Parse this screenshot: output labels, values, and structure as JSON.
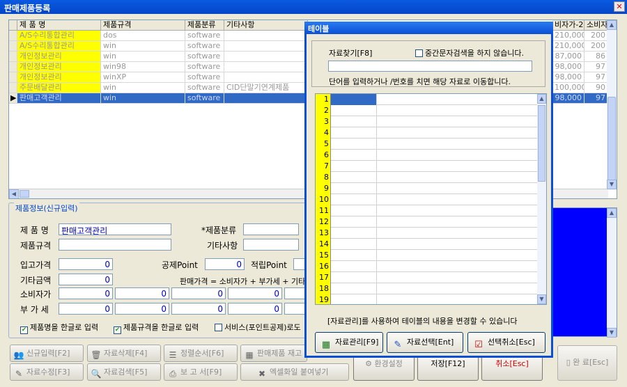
{
  "window": {
    "title": "판매제품등록",
    "close": "✕"
  },
  "grid": {
    "headers": [
      "제 품 명",
      "제품규격",
      "제품분류",
      "기타사항",
      "비자가-2",
      "소비자"
    ],
    "rows": [
      {
        "name": "A/S수리통합관리",
        "spec": "dos",
        "cat": "software",
        "etc": "",
        "p1": "210,000",
        "p2": "200"
      },
      {
        "name": "A/S수리통합관리",
        "spec": "win",
        "cat": "software",
        "etc": "",
        "p1": "210,000",
        "p2": "200"
      },
      {
        "name": "개인정보관리",
        "spec": "win",
        "cat": "software",
        "etc": "",
        "p1": "87,000",
        "p2": "86"
      },
      {
        "name": "개인정보관리",
        "spec": "win98",
        "cat": "software",
        "etc": "",
        "p1": "98,000",
        "p2": "97"
      },
      {
        "name": "개인정보관리",
        "spec": "winXP",
        "cat": "software",
        "etc": "",
        "p1": "98,000",
        "p2": "97"
      },
      {
        "name": "주문배달관리",
        "spec": "win",
        "cat": "software",
        "etc": "CID단말기연계제품",
        "p1": "100,000",
        "p2": "90"
      },
      {
        "name": "판매고객관리",
        "spec": "win",
        "cat": "software",
        "etc": "",
        "p1": "98,000",
        "p2": "97"
      }
    ]
  },
  "form": {
    "group_label": "제품정보(신규입력)",
    "name_label": "제 품 명",
    "name_value": "판매고객관리",
    "cat_label": "*제품분류",
    "cat_value": "",
    "spec_label": "제품규격",
    "spec_value": "",
    "etc_label": "기타사항",
    "etc_value": "",
    "in_price_label": "입고가격",
    "in_price": "0",
    "deduct_label": "공제Point",
    "deduct": "0",
    "accum_label": "적립Point",
    "accum": "",
    "other_label": "기타금액",
    "other": "0",
    "formula": "판매가격 = 소비자가 + 부가세 + 기타",
    "consumer_label": "소비자가",
    "consumer": [
      "0",
      "0",
      "0",
      "0"
    ],
    "vat_label": "부 가 세",
    "vat": [
      "0",
      "0",
      "0",
      "0"
    ],
    "chk1": "제품명을 한글로 입력",
    "chk2": "제품규격을 한글로 입력",
    "chk3": "서비스(포인트공제)로도"
  },
  "buttons": {
    "new": "신규입력[F2]",
    "delete": "자료삭제[F4]",
    "sort": "정렬순서[F6]",
    "stock": "판매제품 재고",
    "edit": "자료수정[F3]",
    "search": "자료검색[F5]",
    "report": "보 고 서[F9]",
    "excel": "엑셀화일 붙여넣기",
    "env": "환경설정",
    "save": "저장[F12]",
    "cancel": "취소[Esc]",
    "done": "완 료[Esc]"
  },
  "dialog": {
    "title": "테이블",
    "search_label": "자료찾기[F8]",
    "mid_search": "중간문자검색을 하지 않습니다.",
    "search_value": "",
    "hint": "단어를 입력하거나  /번호를 치면 해당 자료로 이동합니다.",
    "row_numbers": [
      "1",
      "2",
      "3",
      "4",
      "5",
      "6",
      "7",
      "8",
      "9",
      "10",
      "11",
      "12",
      "13",
      "14",
      "15",
      "16",
      "17",
      "18",
      "19"
    ],
    "footer": "[자료관리]를 사용하여 테이블의 내용을 변경할 수 있습니다",
    "btn_manage": "자료관리[F9]",
    "btn_select": "자료선택[Ent]",
    "btn_cancel": "선택취소[Esc]"
  }
}
